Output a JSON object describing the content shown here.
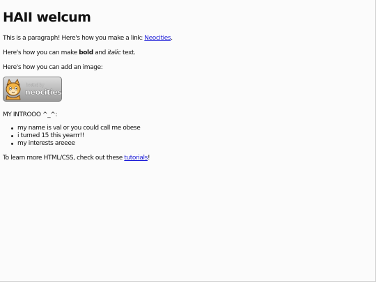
{
  "heading": "HAII welcum",
  "para1": {
    "text": "This is a paragraph! Here's how you make a link: ",
    "link_text": "Neocities",
    "end": "."
  },
  "para2": {
    "text": "Here's how you can make ",
    "bold": "bold",
    "mid": " and ",
    "italic": "italic",
    "end": " text."
  },
  "para3": {
    "text": "Here's how you can add an image:"
  },
  "badge": {
    "line1": "hosted by",
    "line2": "neocities"
  },
  "intro": "MY INTROOO ^_^:",
  "list": [
    "my name is val or you could call me obese",
    "i turned 15 this yearrr!!",
    "my interests areeee"
  ],
  "footer": {
    "text": "To learn more HTML/CSS, check out these ",
    "link_text": "tutorials",
    "end": "!"
  },
  "colors": {
    "link": "#1a1ad8",
    "text": "#111111",
    "background": "#fbfbfb"
  }
}
